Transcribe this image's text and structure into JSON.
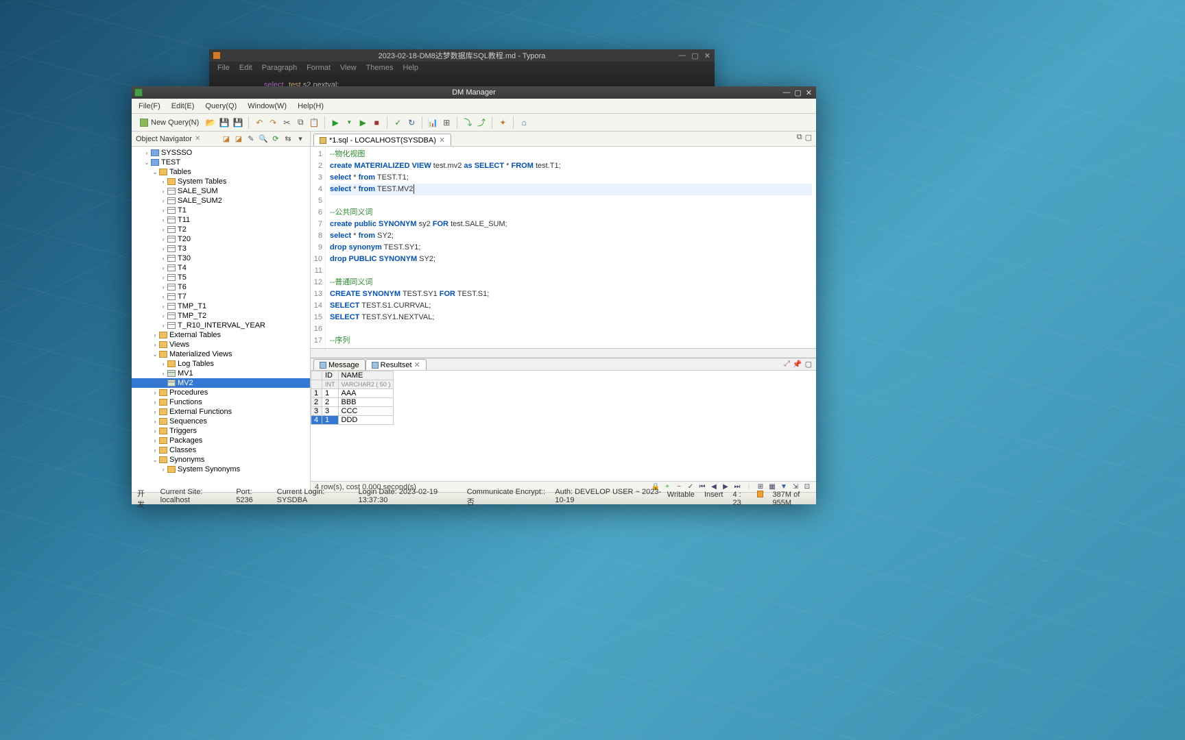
{
  "typora": {
    "title": "2023-02-18-DM8达梦数据库SQL教程.md - Typora",
    "menu": [
      "File",
      "Edit",
      "Paragraph",
      "Format",
      "View",
      "Themes",
      "Help"
    ],
    "code": {
      "kw": "select",
      "test": "test",
      "s2": ".s2",
      "nextval": ".nextval",
      "semi": ";"
    }
  },
  "dm": {
    "title": "DM Manager",
    "menu": [
      "File(F)",
      "Edit(E)",
      "Query(Q)",
      "Window(W)",
      "Help(H)"
    ],
    "new_query": "New Query(N)",
    "nav": {
      "header": "Object Navigator",
      "tree": {
        "syssso": "SYSSSO",
        "test": "TEST",
        "tables": "Tables",
        "system_tables": "System Tables",
        "table_items": [
          "SALE_SUM",
          "SALE_SUM2",
          "T1",
          "T11",
          "T2",
          "T20",
          "T3",
          "T30",
          "T4",
          "T5",
          "T6",
          "T7",
          "TMP_T1",
          "TMP_T2",
          "T_R10_INTERVAL_YEAR"
        ],
        "external_tables": "External Tables",
        "views": "Views",
        "mat_views": "Materialized Views",
        "log_tables": "Log Tables",
        "mv1": "MV1",
        "mv2": "MV2",
        "procedures": "Procedures",
        "functions": "Functions",
        "ext_functions": "External Functions",
        "sequences": "Sequences",
        "triggers": "Triggers",
        "packages": "Packages",
        "classes": "Classes",
        "synonyms": "Synonyms",
        "sys_synonyms": "System Synonyms"
      }
    },
    "editor": {
      "tab": "*1.sql - LOCALHOST(SYSDBA)",
      "lines": [
        {
          "n": 1,
          "t": [
            [
              "cmt",
              "--物化视图"
            ]
          ]
        },
        {
          "n": 2,
          "t": [
            [
              "kw1",
              "create MATERIALIZED VIEW"
            ],
            [
              "id2",
              " test.mv2 "
            ],
            [
              "kw1",
              "as SELECT"
            ],
            [
              "id2",
              " * "
            ],
            [
              "kw1",
              "FROM"
            ],
            [
              "id2",
              " test.T1;"
            ]
          ]
        },
        {
          "n": 3,
          "t": [
            [
              "kw1",
              "select"
            ],
            [
              "id2",
              " * "
            ],
            [
              "kw1",
              "from"
            ],
            [
              "id2",
              " TEST.T1;"
            ]
          ]
        },
        {
          "n": 4,
          "hl": true,
          "t": [
            [
              "kw1",
              "select"
            ],
            [
              "id2",
              " * "
            ],
            [
              "kw1",
              "from"
            ],
            [
              "id2",
              " TEST.MV2"
            ]
          ]
        },
        {
          "n": 5,
          "t": []
        },
        {
          "n": 6,
          "t": [
            [
              "cmt",
              "--公共同义词"
            ]
          ]
        },
        {
          "n": 7,
          "t": [
            [
              "kw1",
              "create public SYNONYM"
            ],
            [
              "id2",
              " sy2 "
            ],
            [
              "kw1",
              "FOR"
            ],
            [
              "id2",
              " test.SALE_SUM;"
            ]
          ]
        },
        {
          "n": 8,
          "t": [
            [
              "kw1",
              "select"
            ],
            [
              "id2",
              " * "
            ],
            [
              "kw1",
              "from"
            ],
            [
              "id2",
              " SY2;"
            ]
          ]
        },
        {
          "n": 9,
          "t": [
            [
              "kw1",
              "drop synonym"
            ],
            [
              "id2",
              " TEST.SY1;"
            ]
          ]
        },
        {
          "n": 10,
          "t": [
            [
              "kw1",
              "drop PUBLIC SYNONYM"
            ],
            [
              "id2",
              " SY2;"
            ]
          ]
        },
        {
          "n": 11,
          "t": []
        },
        {
          "n": 12,
          "t": [
            [
              "cmt",
              "--普通同义词"
            ]
          ]
        },
        {
          "n": 13,
          "t": [
            [
              "kw1",
              "CREATE SYNONYM"
            ],
            [
              "id2",
              " TEST.SY1 "
            ],
            [
              "kw1",
              "FOR"
            ],
            [
              "id2",
              " TEST.S1;"
            ]
          ]
        },
        {
          "n": 14,
          "t": [
            [
              "kw1",
              "SELECT"
            ],
            [
              "id2",
              " TEST.S1.CURRVAL;"
            ]
          ]
        },
        {
          "n": 15,
          "t": [
            [
              "kw1",
              "SELECT"
            ],
            [
              "id2",
              " TEST.SY1.NEXTVAL;"
            ]
          ]
        },
        {
          "n": 16,
          "t": []
        },
        {
          "n": 17,
          "t": [
            [
              "cmt",
              "--序列"
            ]
          ]
        }
      ]
    },
    "results": {
      "tab_msg": "Message",
      "tab_res": "Resultset",
      "cols": [
        {
          "h1": "ID",
          "h2": "INT"
        },
        {
          "h1": "NAME",
          "h2": "VARCHAR2 ( 50 )"
        }
      ],
      "rows": [
        {
          "n": 1,
          "id": "1",
          "name": "AAA"
        },
        {
          "n": 2,
          "id": "2",
          "name": "BBB"
        },
        {
          "n": 3,
          "id": "3",
          "name": "CCC"
        },
        {
          "n": 4,
          "id": "1",
          "name": "DDD",
          "sel": true
        }
      ],
      "summary": "4 row(s), cost 0.000 second(s)"
    },
    "status": {
      "dev": "开发",
      "site": "Current Site: localhost",
      "port": "Port: 5236",
      "login": "Current Login: SYSDBA",
      "date": "Login Date: 2023-02-19 13:37:30",
      "enc": "Communicate Encrypt:: 否",
      "auth": "Auth: DEVELOP USER ~ 2023-10-19",
      "writable": "Writable",
      "insert": "Insert",
      "pos": "4 : 23",
      "mem": "387M of 955M"
    }
  }
}
